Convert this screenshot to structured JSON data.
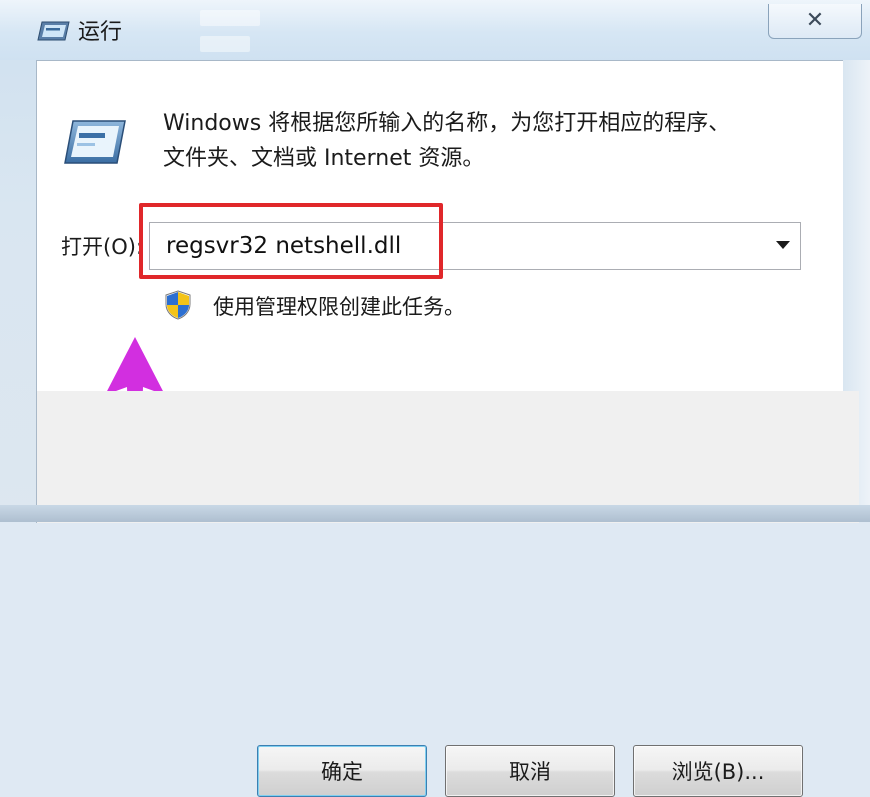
{
  "window": {
    "title": "运行",
    "close_label": "✕"
  },
  "dialog": {
    "description_line1": "Windows 将根据您所输入的名称，为您打开相应的程序、",
    "description_line2": "文件夹、文档或 Internet 资源。",
    "open_label": "打开(O):",
    "open_value": "regsvr32 netshell.dll",
    "admin_text": "使用管理权限创建此任务。"
  },
  "buttons": {
    "ok": "确定",
    "cancel": "取消",
    "browse": "浏览(B)..."
  },
  "icons": {
    "title": "run-icon",
    "main": "run-program-icon",
    "shield": "uac-shield-icon",
    "dropdown": "dropdown-arrow-icon",
    "annotation": "magenta-up-arrow"
  },
  "colors": {
    "highlight": "#e0272a",
    "annotation_arrow": "#d22fe0"
  }
}
